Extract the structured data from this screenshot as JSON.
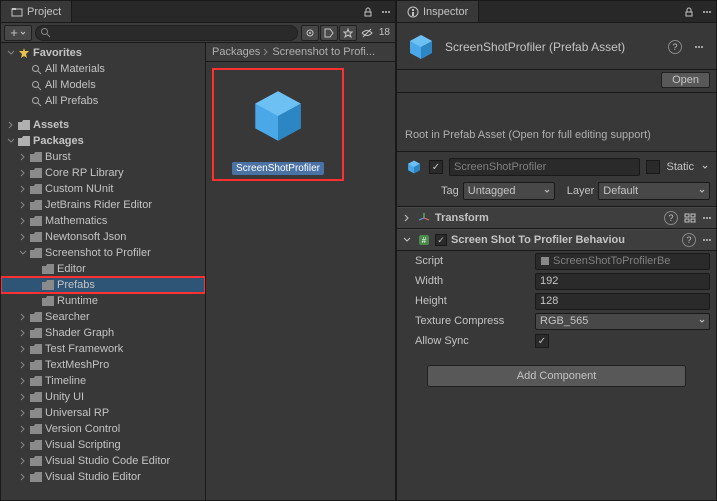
{
  "project": {
    "tab": "Project",
    "search_placeholder": "",
    "hidden_count": "18",
    "breadcrumb": [
      "Packages",
      "Screenshot to Profi..."
    ],
    "asset_name": "ScreenShotProfiler",
    "tree": {
      "favorites": {
        "label": "Favorites",
        "items": [
          "All Materials",
          "All Models",
          "All Prefabs"
        ]
      },
      "assets": {
        "label": "Assets"
      },
      "packages": {
        "label": "Packages",
        "items": [
          "Burst",
          "Core RP Library",
          "Custom NUnit",
          "JetBrains Rider Editor",
          "Mathematics",
          "Newtonsoft Json"
        ],
        "screenshot_pkg": {
          "label": "Screenshot to Profiler",
          "children": [
            "Editor",
            "Prefabs",
            "Runtime"
          ]
        },
        "rest": [
          "Searcher",
          "Shader Graph",
          "Test Framework",
          "TextMeshPro",
          "Timeline",
          "Unity UI",
          "Universal RP",
          "Version Control",
          "Visual Scripting",
          "Visual Studio Code Editor",
          "Visual Studio Editor"
        ]
      }
    }
  },
  "inspector": {
    "tab": "Inspector",
    "title": "ScreenShotProfiler (Prefab Asset)",
    "open_btn": "Open",
    "hint": "Root in Prefab Asset (Open for full editing support)",
    "go_name": "ScreenShotProfiler",
    "static_label": "Static",
    "tag_label": "Tag",
    "tag_value": "Untagged",
    "layer_label": "Layer",
    "layer_value": "Default",
    "transform_title": "Transform",
    "behaviour_title": "Screen Shot To Profiler Behaviou",
    "props": {
      "script_label": "Script",
      "script_value": "ScreenShotToProfilerBe",
      "width_label": "Width",
      "width_value": "192",
      "height_label": "Height",
      "height_value": "128",
      "texcomp_label": "Texture Compress",
      "texcomp_value": "RGB_565",
      "allowsync_label": "Allow Sync"
    },
    "add_component": "Add Component"
  }
}
